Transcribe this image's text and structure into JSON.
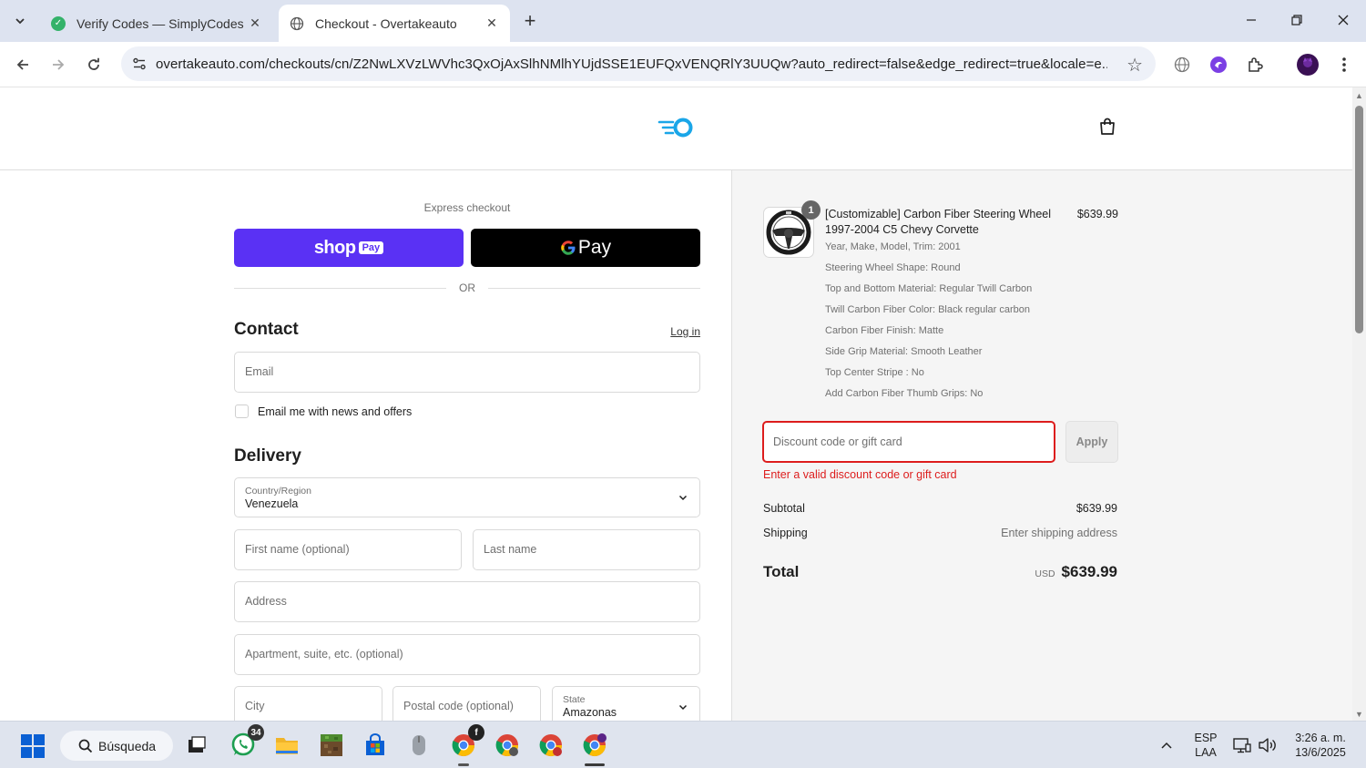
{
  "browser": {
    "tabs": [
      {
        "title": "Verify Codes — SimplyCodes",
        "active": false
      },
      {
        "title": "Checkout - Overtakeauto",
        "active": true
      }
    ],
    "url": "overtakeauto.com/checkouts/cn/Z2NwLXVzLWVhc3QxOjAxSlhNMlhYUjdSSE1EUFQxVENQRlY3UUQw?auto_redirect=false&edge_redirect=true&locale=e..."
  },
  "checkout": {
    "express": {
      "label": "Express checkout",
      "shop_pay": {
        "word": "shop",
        "badge": "Pay"
      },
      "gpay": {
        "label": "Pay"
      },
      "or_label": "OR"
    },
    "contact": {
      "heading": "Contact",
      "login_link": "Log in",
      "email_placeholder": "Email",
      "newsletter_label": "Email me with news and offers"
    },
    "delivery": {
      "heading": "Delivery",
      "country": {
        "label": "Country/Region",
        "value": "Venezuela"
      },
      "first_name_placeholder": "First name (optional)",
      "last_name_placeholder": "Last name",
      "address_placeholder": "Address",
      "apartment_placeholder": "Apartment, suite, etc. (optional)",
      "city_placeholder": "City",
      "postal_placeholder": "Postal code (optional)",
      "state": {
        "label": "State",
        "value": "Amazonas"
      }
    }
  },
  "summary": {
    "product": {
      "quantity": "1",
      "name": "[Customizable] Carbon Fiber Steering Wheel 1997-2004 C5 Chevy Corvette",
      "price": "$639.99",
      "variants": [
        "Year, Make, Model, Trim: 2001",
        "Steering Wheel Shape: Round",
        "Top and Bottom Material: Regular Twill Carbon",
        "Twill Carbon Fiber Color: Black regular carbon",
        "Carbon Fiber Finish: Matte",
        "Side Grip Material: Smooth Leather",
        "Top Center Stripe : No",
        "Add Carbon Fiber Thumb Grips: No"
      ]
    },
    "discount": {
      "placeholder": "Discount code or gift card",
      "apply_label": "Apply",
      "error": "Enter a valid discount code or gift card"
    },
    "subtotal": {
      "label": "Subtotal",
      "value": "$639.99"
    },
    "shipping": {
      "label": "Shipping",
      "value": "Enter shipping address"
    },
    "total": {
      "label": "Total",
      "currency": "USD",
      "value": "$639.99"
    }
  },
  "taskbar": {
    "search_label": "Búsqueda",
    "whatsapp_badge": "34",
    "lang_line1": "ESP",
    "lang_line2": "LAA",
    "time": "3:26 a. m.",
    "date": "13/6/2025"
  },
  "colors": {
    "shop_pay": "#5a31f4",
    "error": "#dd1d1d",
    "brand_logo": "#1aa6e8"
  }
}
